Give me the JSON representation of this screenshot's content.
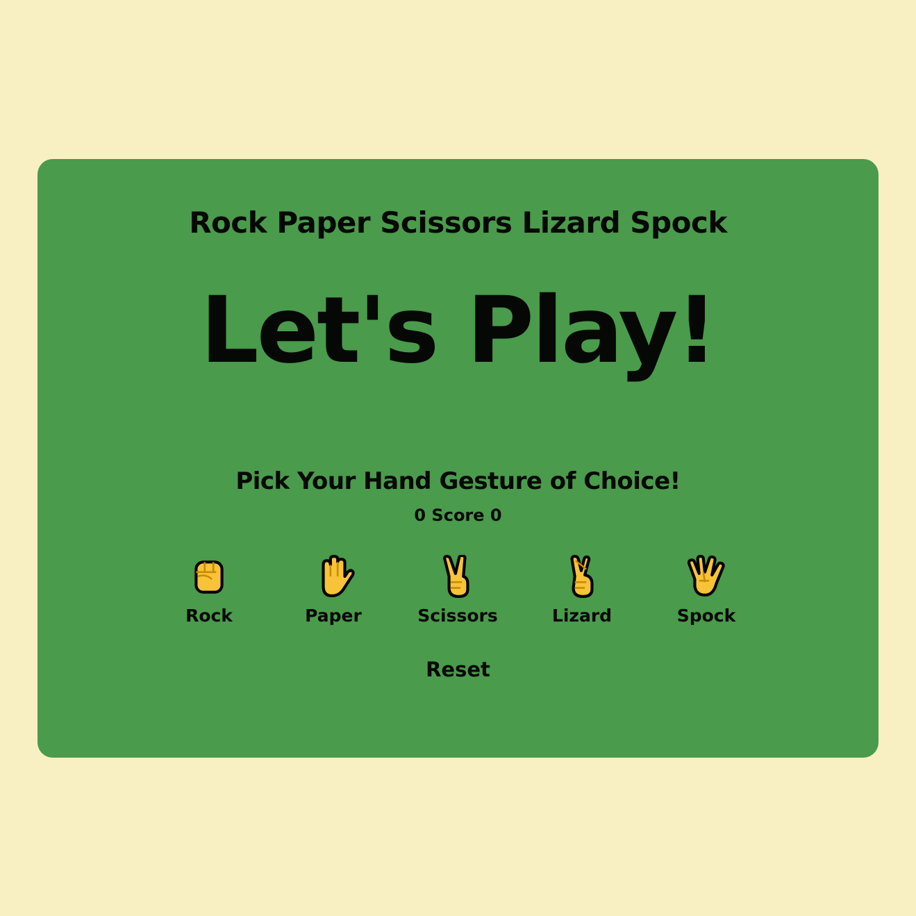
{
  "game": {
    "title": "Rock Paper Scissors Lizard Spock",
    "headline": "Let's Play!",
    "instruction": "Pick Your Hand Gesture of Choice!",
    "score_text": "0 Score 0",
    "reset_label": "Reset"
  },
  "choices": [
    {
      "label": "Rock",
      "icon": "raised-fist-icon"
    },
    {
      "label": "Paper",
      "icon": "raised-hand-icon"
    },
    {
      "label": "Scissors",
      "icon": "victory-hand-icon"
    },
    {
      "label": "Lizard",
      "icon": "crossed-fingers-icon"
    },
    {
      "label": "Spock",
      "icon": "vulcan-salute-icon"
    }
  ],
  "colors": {
    "background": "#f8f0c3",
    "card": "#4a9b4b",
    "text": "#050805",
    "emoji_skin": "#f7c338",
    "emoji_outline": "#000000"
  }
}
